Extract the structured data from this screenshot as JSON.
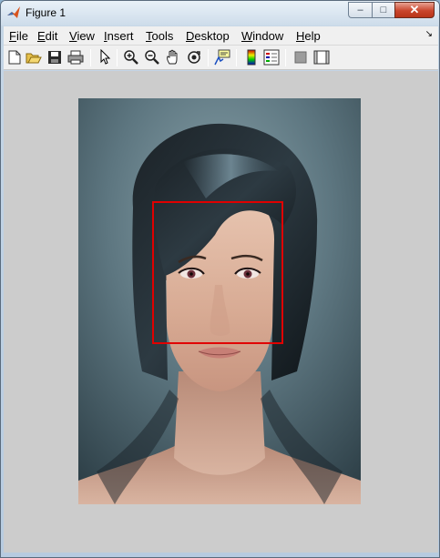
{
  "window": {
    "title": "Figure 1",
    "controls": {
      "minimize": "–",
      "maximize": "□",
      "close": "✕"
    }
  },
  "menubar": {
    "items": [
      {
        "accel": "F",
        "rest": "ile"
      },
      {
        "accel": "E",
        "rest": "dit"
      },
      {
        "accel": "V",
        "rest": "iew"
      },
      {
        "accel": "I",
        "rest": "nsert"
      },
      {
        "accel": "T",
        "rest": "ools"
      },
      {
        "accel": "D",
        "rest": "esktop"
      },
      {
        "accel": "W",
        "rest": "indow"
      },
      {
        "accel": "H",
        "rest": "elp"
      }
    ],
    "overflow_arrow": "↘"
  },
  "toolbar": {
    "buttons": [
      "new-figure-icon",
      "open-file-icon",
      "save-icon",
      "print-icon",
      "edit-plot-pointer-icon",
      "zoom-in-icon",
      "zoom-out-icon",
      "pan-hand-icon",
      "rotate-3d-icon",
      "data-cursor-icon",
      "colorbar-icon",
      "legend-icon",
      "hide-plot-tools-icon",
      "show-plot-tools-icon"
    ]
  },
  "figure": {
    "image_content": "portrait of a short-haired woman (digital painting)",
    "detection_box_color": "#e00000",
    "canvas_color": "#cccccc"
  }
}
